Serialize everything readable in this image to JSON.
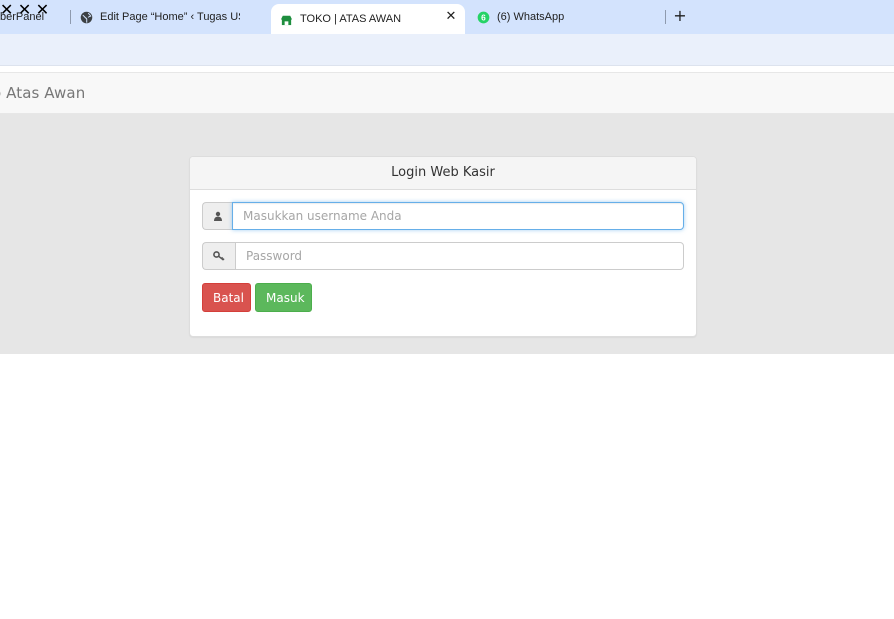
{
  "browser": {
    "tabs": [
      {
        "title": "berPanel",
        "icon": "cyberpanel-icon",
        "active": false
      },
      {
        "title": "Edit Page “Home” ‹ Tugas USK —",
        "icon": "globe-icon",
        "active": false
      },
      {
        "title": "TOKO | ATAS AWAN",
        "icon": "shop-icon",
        "active": true
      },
      {
        "title": "(6) WhatsApp",
        "icon": "whatsapp-icon",
        "active": false,
        "badge": "6"
      }
    ],
    "close_glyph": "✕",
    "new_tab_glyph": "+"
  },
  "navbar": {
    "brand": "o Atas Awan"
  },
  "login": {
    "heading": "Login Web Kasir",
    "username_placeholder": "Masukkan username Anda",
    "username_value": "",
    "password_placeholder": "Password",
    "password_value": "",
    "user_icon": "user-icon",
    "key_icon": "key-icon",
    "cancel_label": "Batal",
    "submit_label": "Masuk"
  },
  "colors": {
    "tabstrip": "#d3e3fd",
    "danger": "#d9534f",
    "success": "#5cb85c",
    "focus": "#66afe9"
  }
}
